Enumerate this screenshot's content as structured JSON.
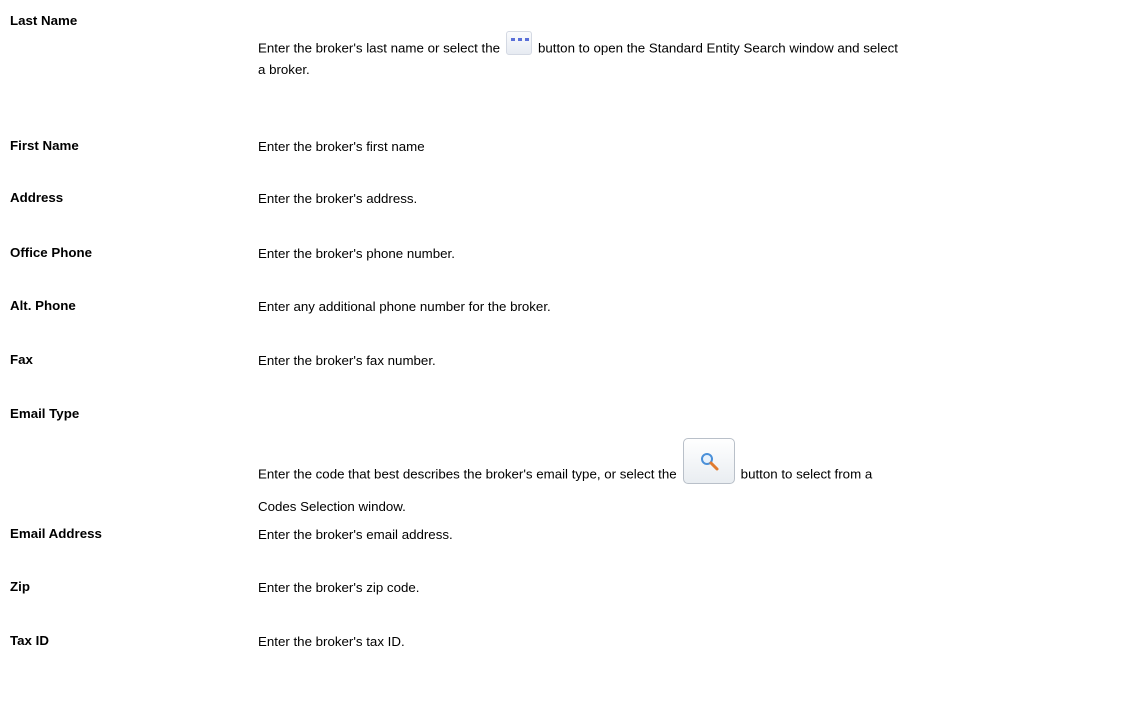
{
  "fields": [
    {
      "label": "Last Name",
      "desc_before": "Enter the broker's last name or select the",
      "button_icon": "ellipsis-icon",
      "desc_after": "button to open the Standard Entity Search window and select a broker."
    },
    {
      "label": "First Name",
      "desc": "Enter the broker's first name"
    },
    {
      "label": "Address",
      "desc": "Enter the broker's address."
    },
    {
      "label": "Office Phone",
      "desc": "Enter the broker's phone number."
    },
    {
      "label": "Alt. Phone",
      "desc": "Enter any additional phone number for the broker."
    },
    {
      "label": "Fax",
      "desc": "Enter the broker's fax number."
    },
    {
      "label": "Email Type",
      "desc_before": "Enter the code that best describes the broker's email type, or select the",
      "button_icon": "magnifier-icon",
      "desc_after": "button to select from a Codes Selection window."
    },
    {
      "label": "Email Address",
      "desc": "Enter the broker's email address."
    },
    {
      "label": "Zip",
      "desc": "Enter the broker's zip code."
    },
    {
      "label": "Tax ID",
      "desc": "Enter the broker's tax ID."
    }
  ],
  "colors": {
    "text": "#000000",
    "ellipsis_dots": "#5a6fd8",
    "button_border": "#b9c0c9",
    "magnifier_lens": "#4a90d9",
    "magnifier_handle": "#e07a2e"
  }
}
